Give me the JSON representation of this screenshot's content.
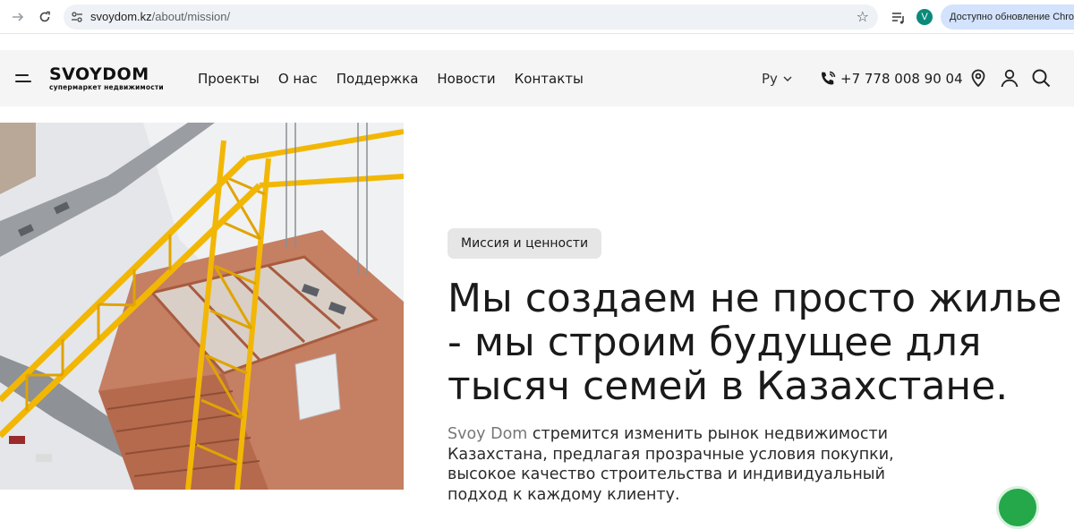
{
  "browser": {
    "url_host": "svoydom.kz",
    "url_path": "/about/mission/",
    "profile_initial": "V",
    "update_label": "Доступно обновление Chrome"
  },
  "header": {
    "logo_main": "SVOYDOM",
    "logo_sub": "супермаркет недвижимости",
    "nav": [
      "Проекты",
      "О нас",
      "Поддержка",
      "Новости",
      "Контакты"
    ],
    "language": "Ру",
    "phone": "+7 778 008 90 04"
  },
  "hero": {
    "badge": "Миссия и ценности",
    "headline": "Мы создаем не просто жилье - мы строим будущее для тысяч семей в Казахстане.",
    "lead_brand": "Svoy Dom",
    "lead_text": " стремится изменить рынок недвижимости Казахстана, предлагая прозрачные условия покупки, высокое качество строительства и индивидуальный подход к каждому клиенту."
  },
  "colors": {
    "header_bg": "#f5f5f5",
    "badge_bg": "#e6e6e6",
    "crane_yellow": "#f2b705",
    "chat_green": "#25a84a"
  }
}
